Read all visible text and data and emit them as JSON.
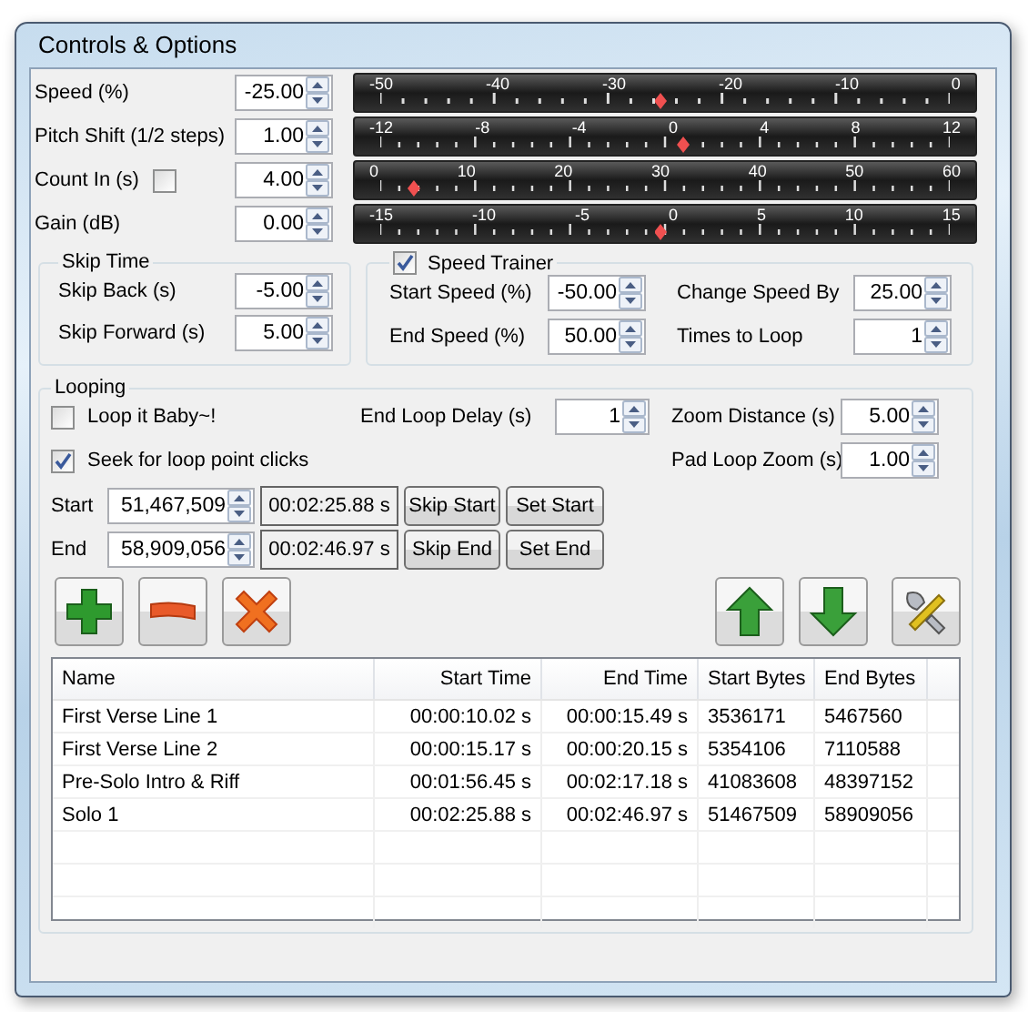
{
  "window": {
    "title": "Controls & Options"
  },
  "controls": [
    {
      "label": "Speed (%)",
      "value": "-25.00",
      "ticks": [
        "-50",
        "-40",
        "-30",
        "-20",
        "-10",
        "0"
      ],
      "level": 0.5
    },
    {
      "label": "Pitch Shift (1/2 steps)",
      "value": "1.00",
      "ticks": [
        "-12",
        "-8",
        "-4",
        "0",
        "4",
        "8",
        "12"
      ],
      "level": 0.54
    },
    {
      "label": "Count In (s)",
      "checkbox": {
        "checked": false
      },
      "value": "4.00",
      "ticks": [
        "0",
        "10",
        "20",
        "30",
        "40",
        "50",
        "60"
      ],
      "level": 0.067
    },
    {
      "label": "Gain (dB)",
      "value": "0.00",
      "ticks": [
        "-15",
        "-10",
        "-5",
        "0",
        "5",
        "10",
        "15"
      ],
      "level": 0.5
    }
  ],
  "skip_time": {
    "title": "Skip Time",
    "fields": [
      {
        "label": "Skip Back (s)",
        "value": "-5.00"
      },
      {
        "label": "Skip Forward (s)",
        "value": "5.00"
      }
    ]
  },
  "speed_trainer": {
    "title": "Speed Trainer",
    "checked": true,
    "fields": [
      {
        "label": "Start Speed (%)",
        "value": "-50.00"
      },
      {
        "label": "Change Speed By",
        "value": "25.00"
      },
      {
        "label": "End Speed (%)",
        "value": "50.00"
      },
      {
        "label": "Times to Loop",
        "value": "1"
      }
    ]
  },
  "looping": {
    "title": "Looping",
    "loop_it": {
      "label": "Loop it Baby~!",
      "checked": false
    },
    "seek": {
      "label": "Seek for loop point clicks",
      "checked": true
    },
    "end_loop_delay": {
      "label": "End Loop Delay (s)",
      "value": "1"
    },
    "zoom_distance": {
      "label": "Zoom Distance (s)",
      "value": "5.00"
    },
    "pad_loop_zoom": {
      "label": "Pad Loop Zoom (s)",
      "value": "1.00"
    },
    "points": [
      {
        "label": "Start",
        "bytes": "51,467,509",
        "time": "00:02:25.88 s",
        "skip": "Skip Start",
        "set": "Set Start"
      },
      {
        "label": "End",
        "bytes": "58,909,056",
        "time": "00:02:46.97 s",
        "skip": "Skip End",
        "set": "Set End"
      }
    ],
    "toolbar": [
      {
        "kind": "add"
      },
      {
        "kind": "remove"
      },
      {
        "kind": "delete"
      },
      {
        "kind": "up"
      },
      {
        "kind": "down"
      },
      {
        "kind": "tools"
      }
    ],
    "table": {
      "columns": [
        "Name",
        "Start Time",
        "End Time",
        "Start Bytes",
        "End Bytes"
      ],
      "rows": [
        [
          "First Verse Line 1",
          "00:00:10.02 s",
          "00:00:15.49 s",
          "3536171",
          "5467560"
        ],
        [
          "First Verse Line 2",
          "00:00:15.17 s",
          "00:00:20.15 s",
          "5354106",
          "7110588"
        ],
        [
          "Pre-Solo Intro & Riff",
          "00:01:56.45 s",
          "00:02:17.18 s",
          "41083608",
          "48397152"
        ],
        [
          "Solo 1",
          "00:02:25.88 s",
          "00:02:46.97 s",
          "51467509",
          "58909056"
        ]
      ]
    }
  }
}
